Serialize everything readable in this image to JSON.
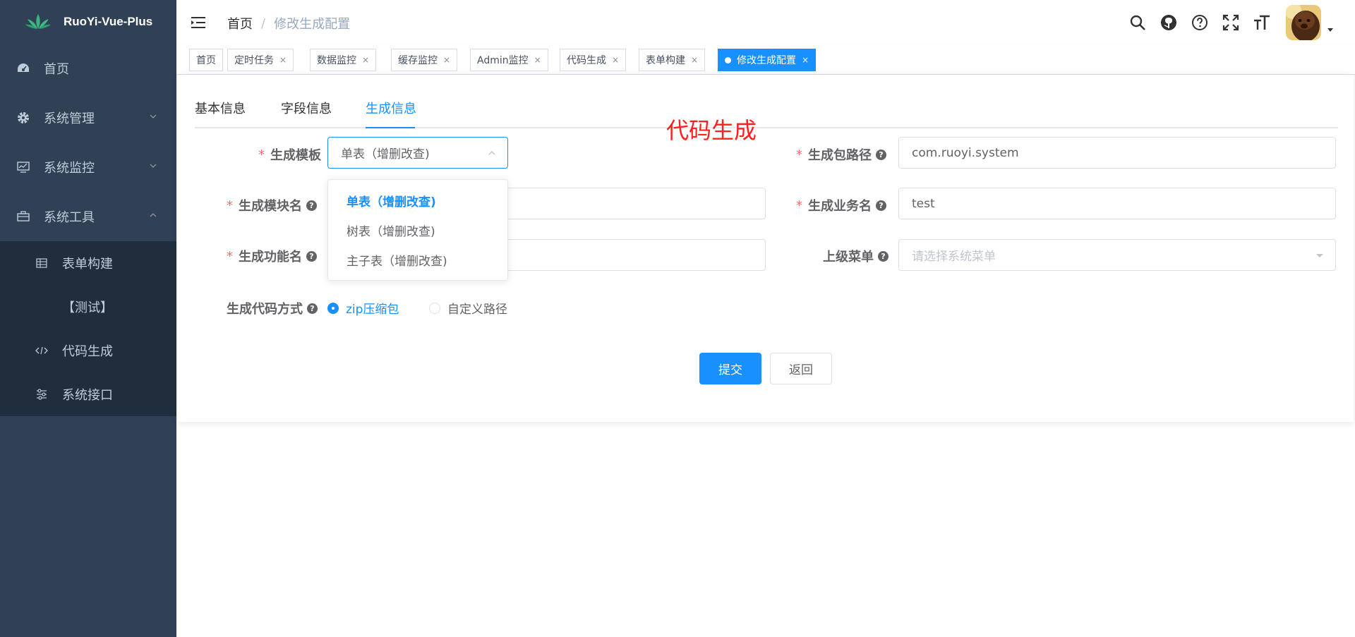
{
  "app": {
    "title": "RuoYi-Vue-Plus"
  },
  "sidebar": {
    "items": [
      {
        "label": "首页",
        "icon": "dashboard-icon"
      },
      {
        "label": "系统管理",
        "icon": "gear-icon"
      },
      {
        "label": "系统监控",
        "icon": "monitor-icon"
      },
      {
        "label": "系统工具",
        "icon": "toolbox-icon"
      }
    ],
    "tool_children": [
      {
        "label": "表单构建",
        "icon": "table-icon"
      },
      {
        "label": "【测试】",
        "icon": ""
      },
      {
        "label": "代码生成",
        "icon": "code-icon"
      },
      {
        "label": "系统接口",
        "icon": "sliders-icon"
      }
    ]
  },
  "breadcrumb": {
    "home": "首页",
    "sep": "/",
    "current": "修改生成配置"
  },
  "tags": [
    {
      "label": "首页",
      "closable": false
    },
    {
      "label": "定时任务",
      "close": "×"
    },
    {
      "label": "数据监控",
      "close": "×"
    },
    {
      "label": "缓存监控",
      "close": "×"
    },
    {
      "label": "Admin监控",
      "close": "×"
    },
    {
      "label": "代码生成",
      "close": "×"
    },
    {
      "label": "表单构建",
      "close": "×"
    },
    {
      "label": "修改生成配置",
      "close": "×",
      "active": true
    }
  ],
  "tabs": [
    {
      "label": "基本信息"
    },
    {
      "label": "字段信息"
    },
    {
      "label": "生成信息",
      "active": true
    }
  ],
  "watermark": "代码生成",
  "form": {
    "required_mark": "*",
    "help_mark": "?",
    "template": {
      "label": "生成模板",
      "value": "单表（增删改查)"
    },
    "template_options": [
      "单表（增删改查)",
      "树表（增删改查)",
      "主子表（增删改查)"
    ],
    "package": {
      "label": "生成包路径",
      "value": "com.ruoyi.system"
    },
    "module": {
      "label": "生成模块名",
      "value": ""
    },
    "business": {
      "label": "生成业务名",
      "value": "test"
    },
    "function": {
      "label": "生成功能名",
      "value": ""
    },
    "parent_menu": {
      "label": "上级菜单",
      "placeholder": "请选择系统菜单"
    },
    "gen_type": {
      "label": "生成代码方式",
      "options": [
        "zip压缩包",
        "自定义路径"
      ],
      "selected": "zip压缩包"
    }
  },
  "buttons": {
    "submit": "提交",
    "back": "返回"
  },
  "colors": {
    "sidebar_bg": "#304156",
    "submenu_bg": "#1f2d3d",
    "primary": "#1890ff",
    "required": "#f56c6c",
    "watermark": "#ff2020"
  }
}
